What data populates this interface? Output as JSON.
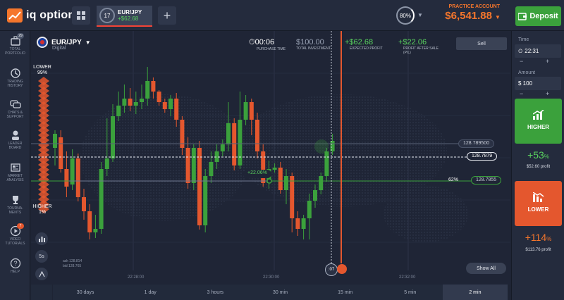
{
  "header": {
    "logo_text": "iq option",
    "tab": {
      "timer": "17",
      "asset": "EUR/JPY",
      "profit": "+$62.68"
    },
    "add_label": "+",
    "level": "80%",
    "account_label": "PRACTICE ACCOUNT",
    "balance": "$6,541.88",
    "deposit_label": "Deposit"
  },
  "sidebar": {
    "items": [
      {
        "name": "total-portfolio",
        "icon": "briefcase-icon",
        "label": "TOTAL\nPORTFOLIO",
        "badge": "29"
      },
      {
        "name": "trading-history",
        "icon": "history-icon",
        "label": "TRADING\nHISTORY",
        "badge": ""
      },
      {
        "name": "chats-support",
        "icon": "chat-icon",
        "label": "CHATS &\nSUPPORT",
        "badge": ""
      },
      {
        "name": "leader-board",
        "icon": "trophy-person-icon",
        "label": "LEADER\nBOARD",
        "badge": ""
      },
      {
        "name": "market-analysis",
        "icon": "newspaper-icon",
        "label": "MARKET\nANALYSIS",
        "badge": ""
      },
      {
        "name": "tournaments",
        "icon": "trophy-icon",
        "label": "TOURNA-\nMENTS",
        "badge": ""
      },
      {
        "name": "video-tutorials",
        "icon": "play-icon",
        "label": "VIDEO\nTUTORIALS",
        "badge": "7"
      },
      {
        "name": "help",
        "icon": "question-icon",
        "label": "HELP",
        "badge": ""
      }
    ]
  },
  "asset": {
    "name": "EUR/JPY",
    "type": "Digital"
  },
  "stats": [
    {
      "name": "purchase-time",
      "value": "00:06",
      "label": "PURCHASE TIME",
      "color": "#ffffff"
    },
    {
      "name": "total-investment",
      "value": "$100.00",
      "label": "TOTAL INVESTMENT",
      "color": "#9aa3b5"
    },
    {
      "name": "expected-profit",
      "value": "+$62.68",
      "label": "EXPECTED PROFIT",
      "color": "#5ad35f"
    },
    {
      "name": "profit-after-sale",
      "value": "+$22.06",
      "label": "PROFIT AFTER SALE\n(P/L)",
      "color": "#5ad35f"
    }
  ],
  "sell_label": "Sell",
  "sentiment": {
    "lower_label": "LOWER",
    "lower_pct": "99%",
    "higher_label": "HIGHER",
    "higher_pct": "1%"
  },
  "price_tags": {
    "upper": "128.789500",
    "current": "128.7879",
    "strike_pct": "62%",
    "strike": "128.7855"
  },
  "trade_marker": "+22.06%",
  "timer_left": ":07",
  "ask": "ask 128.814",
  "bid": "bid 128.765",
  "tools": [
    "indicators-icon",
    "5s",
    "draw-icon",
    "line-icon"
  ],
  "time_labels": [
    "22:28:00",
    "22:30:00",
    "22:32:00"
  ],
  "show_all_label": "Show All",
  "timeframes": [
    "30 days",
    "1 day",
    "3 hours",
    "30 min",
    "15 min",
    "5 min",
    "2 min"
  ],
  "active_timeframe": "2 min",
  "right_panel": {
    "time_label": "Time",
    "time_value": "22:31",
    "amount_label": "Amount",
    "amount_value": "$ 100",
    "higher_label": "HIGHER",
    "higher_pct": "+53",
    "higher_profit": "$52.60 profit",
    "lower_label": "LOWER",
    "lower_pct": "+114",
    "lower_profit": "$113.76 profit",
    "pct_sign": "%"
  },
  "colors": {
    "green": "#3ba13c",
    "red": "#e4572e",
    "orange": "#f5762c",
    "bg": "#1e2434"
  },
  "candles": [
    {
      "o": 210,
      "c": 190,
      "h": 185,
      "l": 235
    },
    {
      "o": 195,
      "c": 240,
      "h": 185,
      "l": 245
    },
    {
      "o": 240,
      "c": 265,
      "h": 215,
      "l": 280
    },
    {
      "o": 262,
      "c": 225,
      "h": 212,
      "l": 270
    },
    {
      "o": 225,
      "c": 280,
      "h": 218,
      "l": 286
    },
    {
      "o": 280,
      "c": 300,
      "h": 268,
      "l": 312
    },
    {
      "o": 300,
      "c": 330,
      "h": 290,
      "l": 340
    },
    {
      "o": 330,
      "c": 325,
      "h": 305,
      "l": 338
    },
    {
      "o": 325,
      "c": 240,
      "h": 230,
      "l": 332
    },
    {
      "o": 240,
      "c": 225,
      "h": 168,
      "l": 250
    },
    {
      "o": 225,
      "c": 165,
      "h": 148,
      "l": 230
    },
    {
      "o": 165,
      "c": 150,
      "h": 130,
      "l": 172
    },
    {
      "o": 150,
      "c": 140,
      "h": 120,
      "l": 160
    },
    {
      "o": 140,
      "c": 150,
      "h": 125,
      "l": 158
    },
    {
      "o": 150,
      "c": 145,
      "h": 130,
      "l": 162
    },
    {
      "o": 145,
      "c": 140,
      "h": 120,
      "l": 155
    },
    {
      "o": 140,
      "c": 115,
      "h": 95,
      "l": 150
    },
    {
      "o": 115,
      "c": 130,
      "h": 110,
      "l": 140
    },
    {
      "o": 130,
      "c": 145,
      "h": 128,
      "l": 150
    },
    {
      "o": 145,
      "c": 155,
      "h": 140,
      "l": 160
    },
    {
      "o": 155,
      "c": 140,
      "h": 135,
      "l": 165
    },
    {
      "o": 140,
      "c": 170,
      "h": 132,
      "l": 180
    },
    {
      "o": 170,
      "c": 210,
      "h": 165,
      "l": 220
    },
    {
      "o": 210,
      "c": 260,
      "h": 195,
      "l": 268
    },
    {
      "o": 260,
      "c": 210,
      "h": 205,
      "l": 270
    },
    {
      "o": 210,
      "c": 320,
      "h": 200,
      "l": 326
    },
    {
      "o": 320,
      "c": 250,
      "h": 240,
      "l": 330
    },
    {
      "o": 250,
      "c": 230,
      "h": 215,
      "l": 260
    },
    {
      "o": 230,
      "c": 215,
      "h": 205,
      "l": 240
    },
    {
      "o": 215,
      "c": 205,
      "h": 198,
      "l": 222
    },
    {
      "o": 205,
      "c": 175,
      "h": 145,
      "l": 215
    },
    {
      "o": 175,
      "c": 235,
      "h": 168,
      "l": 242
    },
    {
      "o": 235,
      "c": 170,
      "h": 130,
      "l": 240
    },
    {
      "o": 170,
      "c": 145,
      "h": 135,
      "l": 178
    },
    {
      "o": 145,
      "c": 170,
      "h": 140,
      "l": 192
    },
    {
      "o": 170,
      "c": 215,
      "h": 160,
      "l": 225
    },
    {
      "o": 215,
      "c": 260,
      "h": 205,
      "l": 265
    },
    {
      "o": 260,
      "c": 240,
      "h": 228,
      "l": 268
    },
    {
      "o": 240,
      "c": 238,
      "h": 232,
      "l": 245
    },
    {
      "o": 238,
      "c": 270,
      "h": 230,
      "l": 275
    },
    {
      "o": 270,
      "c": 250,
      "h": 240,
      "l": 290
    },
    {
      "o": 250,
      "c": 310,
      "h": 245,
      "l": 330
    },
    {
      "o": 310,
      "c": 325,
      "h": 300,
      "l": 335
    },
    {
      "o": 325,
      "c": 310,
      "h": 305,
      "l": 340
    },
    {
      "o": 310,
      "c": 285,
      "h": 275,
      "l": 340
    },
    {
      "o": 285,
      "c": 270,
      "h": 262,
      "l": 295
    },
    {
      "o": 270,
      "c": 250,
      "h": 245,
      "l": 276
    },
    {
      "o": 250,
      "c": 215,
      "h": 210,
      "l": 258
    },
    {
      "o": 215,
      "c": 200,
      "h": 190,
      "l": 220
    }
  ]
}
